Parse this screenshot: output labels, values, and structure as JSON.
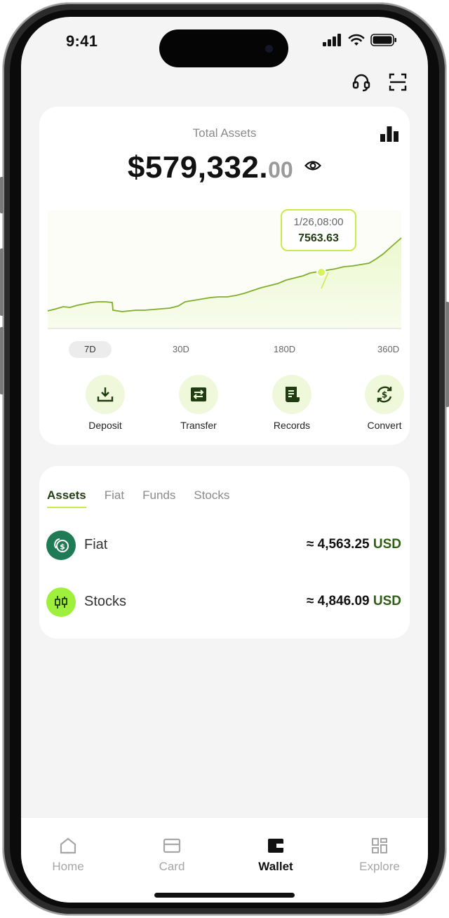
{
  "status_bar": {
    "time": "9:41"
  },
  "top_actions": {
    "support_icon": "headset-icon",
    "scan_icon": "scan-icon"
  },
  "assets_card": {
    "title": "Total Assets",
    "balance_main": "$579,332.",
    "balance_decimals": "00",
    "chart_icon": "bar-chart-icon",
    "visibility_icon": "eye-icon",
    "tooltip": {
      "date": "1/26,08:00",
      "value": "7563.63"
    },
    "ranges": [
      "7D",
      "30D",
      "180D",
      "360D"
    ],
    "active_range": "7D",
    "actions": [
      {
        "label": "Deposit",
        "icon": "download-icon"
      },
      {
        "label": "Transfer",
        "icon": "swap-arrows-icon"
      },
      {
        "label": "Records",
        "icon": "document-icon"
      },
      {
        "label": "Convert",
        "icon": "convert-currency-icon"
      }
    ]
  },
  "holdings": {
    "tabs": [
      "Assets",
      "Fiat",
      "Funds",
      "Stocks"
    ],
    "active_tab": "Assets",
    "rows": [
      {
        "name": "Fiat",
        "amount": "≈ 4,563.25",
        "unit": "USD",
        "icon": "coins-icon"
      },
      {
        "name": "Stocks",
        "amount": "≈ 4,846.09",
        "unit": "USD",
        "icon": "candlestick-icon"
      }
    ]
  },
  "bottom_nav": {
    "items": [
      {
        "label": "Home",
        "icon": "home-icon"
      },
      {
        "label": "Card",
        "icon": "card-icon"
      },
      {
        "label": "Wallet",
        "icon": "wallet-icon"
      },
      {
        "label": "Explore",
        "icon": "grid-icon"
      }
    ],
    "active": "Wallet"
  },
  "colors": {
    "accent": "#c8ec4a",
    "dark_green": "#234012",
    "fiat_icon_bg": "#1e7b55",
    "stocks_icon_bg": "#9ef03c"
  }
}
